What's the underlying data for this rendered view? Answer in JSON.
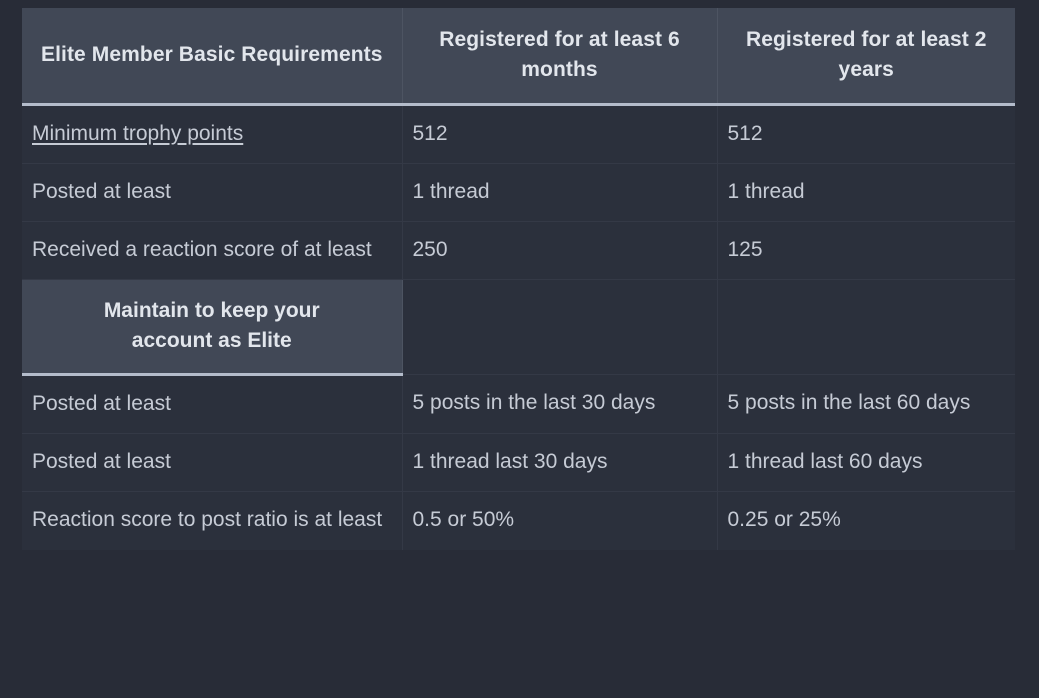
{
  "page": {
    "background_color": "#282c37",
    "table_background": "#2b303c",
    "header_background": "#414856",
    "header_rule_color": "#b4bccb",
    "text_color": "#c6cbd5",
    "header_text_color": "#e2e6ec",
    "grid_color": "#343946"
  },
  "table": {
    "columns": [
      {
        "label": "Elite Member Basic Requirements"
      },
      {
        "label": "Registered for at least 6 months"
      },
      {
        "label": "Registered for at least 2 years"
      }
    ],
    "basic_rows": [
      {
        "requirement": "Minimum trophy points",
        "requirement_is_link": true,
        "six_months": "512",
        "two_years": "512"
      },
      {
        "requirement": "Posted at least",
        "requirement_is_link": false,
        "six_months": "1 thread",
        "two_years": "1 thread"
      },
      {
        "requirement": "Received a reaction score of at least",
        "requirement_is_link": false,
        "six_months": "250",
        "two_years": "125"
      }
    ],
    "section_heading": "Maintain to keep your account as Elite",
    "maintain_rows": [
      {
        "requirement": "Posted at least",
        "six_months": "5 posts in the last 30 days",
        "two_years": "5 posts in the last 60 days"
      },
      {
        "requirement": "Posted at least",
        "six_months": "1 thread last 30 days",
        "two_years": "1 thread last 60 days"
      },
      {
        "requirement": "Reaction score to post ratio is at least",
        "six_months": "0.5 or 50%",
        "two_years": "0.25 or 25%"
      }
    ]
  }
}
